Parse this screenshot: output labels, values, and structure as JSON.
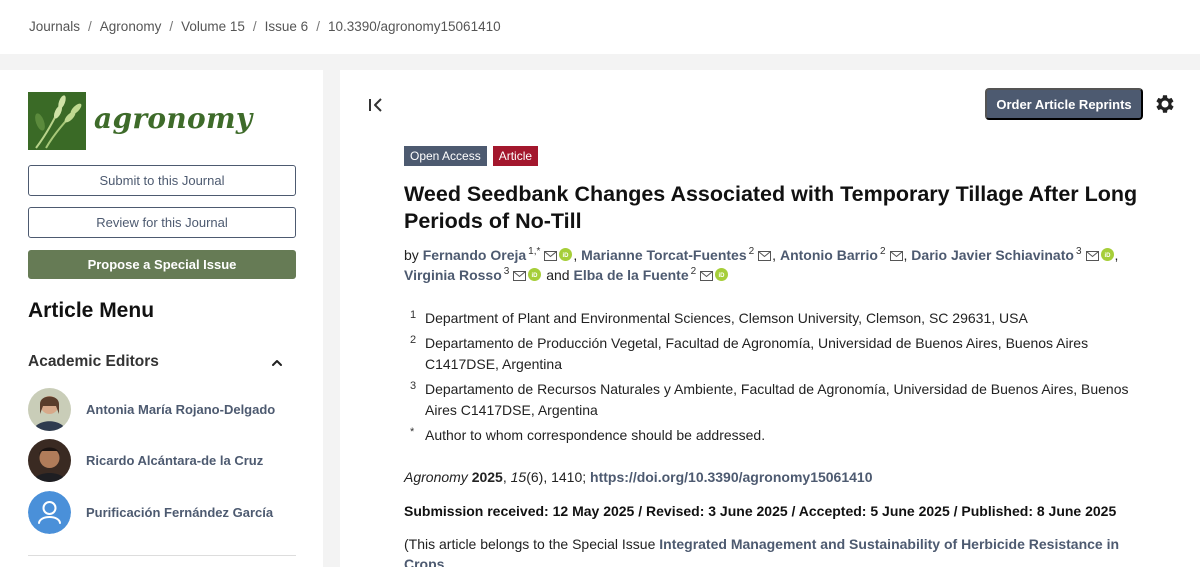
{
  "breadcrumb": [
    "Journals",
    "Agronomy",
    "Volume 15",
    "Issue 6",
    "10.3390/agronomy15061410"
  ],
  "journal": {
    "logo_text": "agronomy"
  },
  "sidebar": {
    "submit_label": "Submit to this Journal",
    "review_label": "Review for this Journal",
    "propose_label": "Propose a Special Issue",
    "menu_title": "Article Menu",
    "editors_heading": "Academic Editors",
    "editors": [
      {
        "name": "Antonia María Rojano-Delgado"
      },
      {
        "name": "Ricardo Alcántara-de la Cruz"
      },
      {
        "name": "Purificación Fernández García"
      }
    ]
  },
  "header": {
    "order_label": "Order Article Reprints"
  },
  "article": {
    "tags": [
      "Open Access",
      "Article"
    ],
    "title": "Weed Seedbank Changes Associated with Temporary Tillage After Long Periods of No-Till",
    "by": "by",
    "authors": [
      {
        "name": "Fernando Oreja",
        "sup": "1,*"
      },
      {
        "name": "Marianne Torcat-Fuentes",
        "sup": "2"
      },
      {
        "name": "Antonio Barrio",
        "sup": "2"
      },
      {
        "name": "Dario Javier Schiavinato",
        "sup": "3"
      },
      {
        "name": "Virginia Rosso",
        "sup": "3"
      },
      {
        "name": "Elba de la Fuente",
        "sup": "2"
      }
    ],
    "and_word": "and",
    "affiliations": [
      {
        "num": "1",
        "text": "Department of Plant and Environmental Sciences, Clemson University, Clemson, SC 29631, USA"
      },
      {
        "num": "2",
        "text": "Departamento de Producción Vegetal, Facultad de Agronomía, Universidad de Buenos Aires, Buenos Aires C1417DSE, Argentina"
      },
      {
        "num": "3",
        "text": "Departamento de Recursos Naturales y Ambiente, Facultad de Agronomía, Universidad de Buenos Aires, Buenos Aires C1417DSE, Argentina"
      },
      {
        "num": "*",
        "text": "Author to whom correspondence should be addressed."
      }
    ],
    "citation": {
      "journal": "Agronomy",
      "year": "2025",
      "volume": "15",
      "rest": "(6), 1410; ",
      "doi": "https://doi.org/10.3390/agronomy15061410"
    },
    "dates": "Submission received: 12 May 2025 / Revised: 3 June 2025 / Accepted: 5 June 2025 / Published: 8 June 2025",
    "special_issue": {
      "prefix": "(This article belongs to the Special Issue ",
      "link": "Integrated Management and Sustainability of Herbicide Resistance in Crops"
    }
  },
  "colors": {
    "accent": "#4d5a70",
    "journal_green": "#667b55",
    "article_tag": "#a3172d",
    "orcid": "#a6ce39"
  },
  "icons": [
    "collapse-sidebar-icon",
    "gear-icon",
    "chevron-up-icon",
    "mail-icon",
    "orcid-icon",
    "user-icon"
  ]
}
